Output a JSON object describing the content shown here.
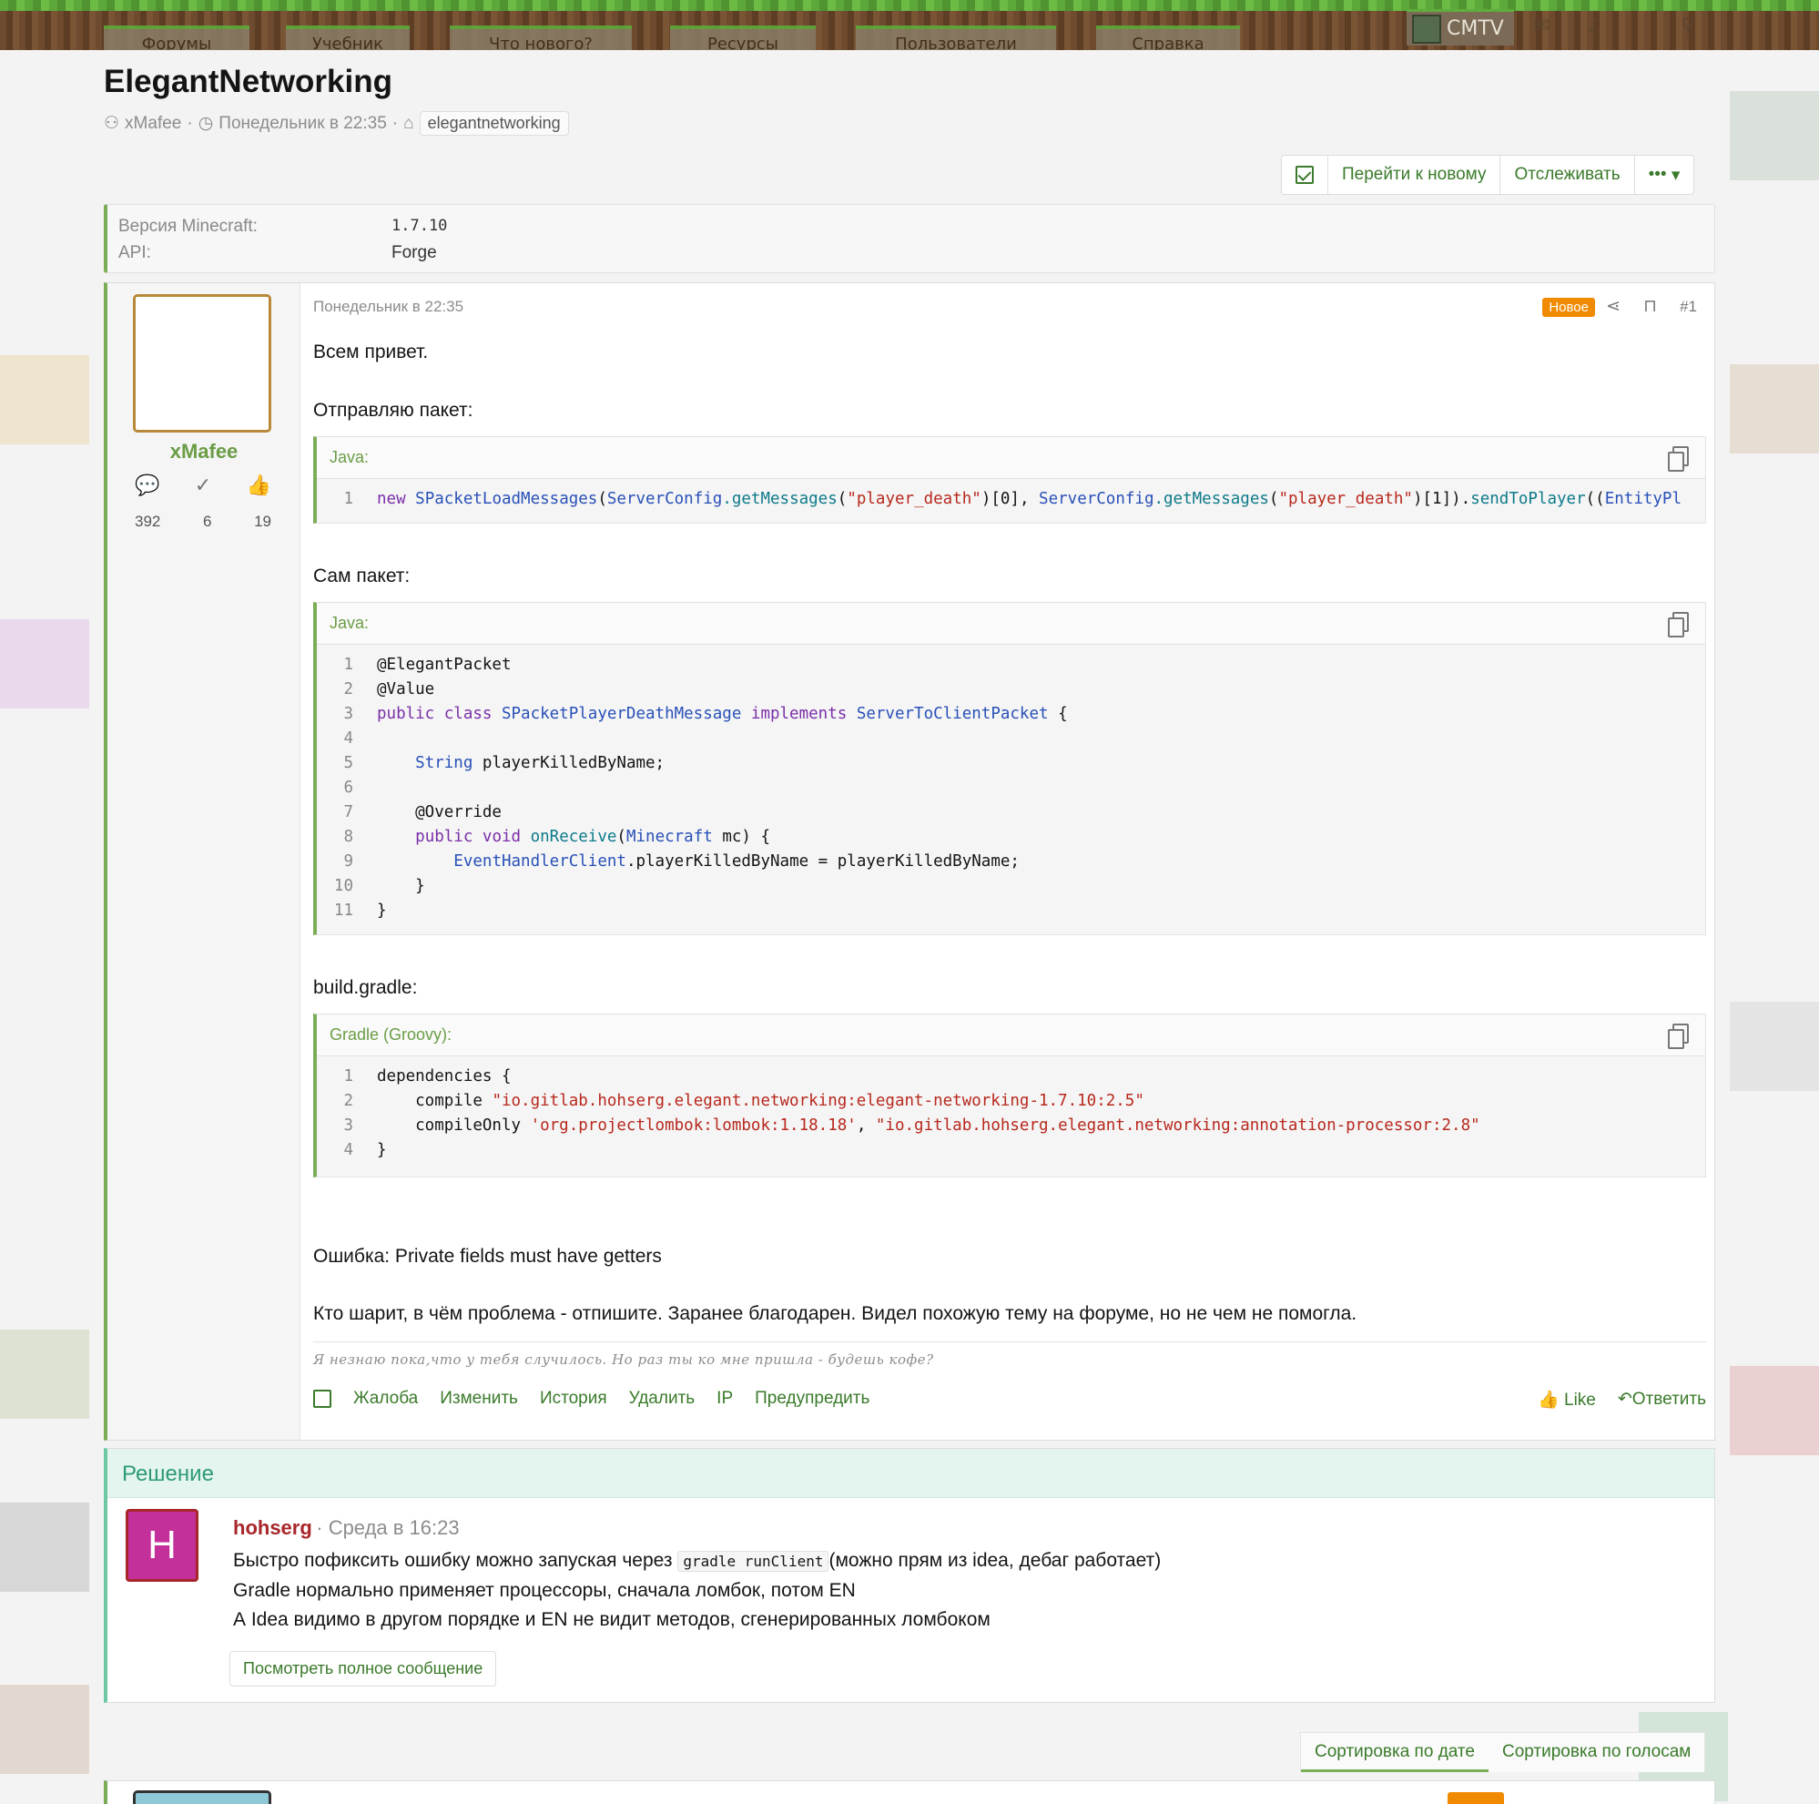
{
  "header": {
    "nav_tabs": [
      "Форумы",
      "Учебник",
      "Что нового?",
      "Ресурсы",
      "Пользователи",
      "Справка"
    ],
    "username": "CMTV"
  },
  "thread": {
    "title": "ElegantNetworking",
    "author": "xMafee",
    "date": "Понедельник в 22:35",
    "tag": "elegantnetworking"
  },
  "toolbar": {
    "goto_new": "Перейти к новому",
    "watch": "Отслеживать",
    "more": "•••"
  },
  "fields": [
    {
      "label": "Версия Minecraft:",
      "value": "1.7.10"
    },
    {
      "label": "API:",
      "value": "Forge"
    }
  ],
  "post": {
    "author": "xMafee",
    "stats": {
      "messages": "392",
      "solutions": "6",
      "likes": "19"
    },
    "date": "Понедельник в 22:35",
    "badge": "Новое",
    "number": "#1",
    "greeting": "Всем привет.",
    "sending_packet": "Отправляю пакет:",
    "code1_lang": "Java:",
    "packet_itself": "Сам пакет:",
    "code2_lang": "Java:",
    "build_gradle": "build.gradle:",
    "code3_lang": "Gradle (Groovy):",
    "error": "Ошибка: Private fields must have getters",
    "request": "Кто шарит, в чём проблема - отпишите. Заранее благодарен. Видел похожую тему на форуме, но не чем не помогла.",
    "signature": "Я незнаю пока,что у тебя случилось. Но раз ты ко мне пришла - будешь кофе?",
    "actions": [
      "Жалоба",
      "Изменить",
      "История",
      "Удалить",
      "IP",
      "Предупредить"
    ],
    "like": "Like",
    "reply": "Ответить"
  },
  "solution": {
    "heading": "Решение",
    "avatar_letter": "H",
    "author": "hohserg",
    "date": "· Среда в 16:23",
    "line1_before": "Быстро пофиксить ошибку можно запуская через ",
    "line1_code": "gradle runClient",
    "line1_after": "(можно прям из idea, дебаг работает)",
    "line2": "Gradle нормально применяет процессоры, сначала ломбок, потом EN",
    "line3": "А Idea видимо в другом порядке и EN не видит методов, сгенерированных ломбоком",
    "full_message": "Посмотреть полное сообщение"
  },
  "sort": {
    "by_date": "Сортировка по дате",
    "by_votes": "Сортировка по голосам"
  },
  "code1": [
    {
      "n": "1",
      "parts": [
        [
          "kw",
          "new "
        ],
        [
          "ty",
          "SPacketLoadMessages"
        ],
        [
          "",
          "("
        ],
        [
          "ty",
          "ServerConfig"
        ],
        [
          "",
          ""
        ],
        [
          "nm",
          ".getMessages"
        ],
        [
          "",
          "("
        ],
        [
          "st",
          "\"player_death\""
        ],
        [
          "",
          ")[0], "
        ],
        [
          "ty",
          "ServerConfig"
        ],
        [
          "nm",
          ".getMessages"
        ],
        [
          "",
          "("
        ],
        [
          "st",
          "\"player_death\""
        ],
        [
          "",
          ")[1])."
        ],
        [
          "nm",
          "sendToPlayer"
        ],
        [
          "",
          "(("
        ],
        [
          "ty",
          "EntityPl"
        ]
      ]
    }
  ],
  "code2": [
    {
      "n": "1",
      "parts": [
        [
          "",
          "@ElegantPacket"
        ]
      ]
    },
    {
      "n": "2",
      "parts": [
        [
          "",
          "@Value"
        ]
      ]
    },
    {
      "n": "3",
      "parts": [
        [
          "kw",
          "public class "
        ],
        [
          "ty",
          "SPacketPlayerDeathMessage "
        ],
        [
          "kw",
          "implements "
        ],
        [
          "ty",
          "ServerToClientPacket"
        ],
        [
          "",
          " {"
        ]
      ]
    },
    {
      "n": "4",
      "parts": [
        [
          "",
          ""
        ]
      ]
    },
    {
      "n": "5",
      "parts": [
        [
          "",
          "    "
        ],
        [
          "ty",
          "String"
        ],
        [
          "",
          " playerKilledByName;"
        ]
      ]
    },
    {
      "n": "6",
      "parts": [
        [
          "",
          ""
        ]
      ]
    },
    {
      "n": "7",
      "parts": [
        [
          "",
          "    @Override"
        ]
      ]
    },
    {
      "n": "8",
      "parts": [
        [
          "",
          "    "
        ],
        [
          "kw",
          "public void "
        ],
        [
          "nm",
          "onReceive"
        ],
        [
          "",
          "("
        ],
        [
          "ty",
          "Minecraft"
        ],
        [
          "",
          " mc) {"
        ]
      ]
    },
    {
      "n": "9",
      "parts": [
        [
          "",
          "        "
        ],
        [
          "ty",
          "EventHandlerClient"
        ],
        [
          "",
          ".playerKilledByName = playerKilledByName;"
        ]
      ]
    },
    {
      "n": "10",
      "parts": [
        [
          "",
          "    }"
        ]
      ]
    },
    {
      "n": "11",
      "parts": [
        [
          "",
          "}"
        ]
      ]
    }
  ],
  "code3": [
    {
      "n": "1",
      "parts": [
        [
          "",
          "dependencies {"
        ]
      ]
    },
    {
      "n": "2",
      "parts": [
        [
          "",
          "    compile "
        ],
        [
          "st",
          "\"io.gitlab.hohserg.elegant.networking:elegant-networking-1.7.10:2.5\""
        ]
      ]
    },
    {
      "n": "3",
      "parts": [
        [
          "",
          "    compileOnly "
        ],
        [
          "st",
          "'org.projectlombok:lombok:1.18.18'"
        ],
        [
          "",
          ", "
        ],
        [
          "st",
          "\"io.gitlab.hohserg.elegant.networking:annotation-processor:2.8\""
        ]
      ]
    },
    {
      "n": "4",
      "parts": [
        [
          "",
          "}"
        ]
      ]
    }
  ]
}
